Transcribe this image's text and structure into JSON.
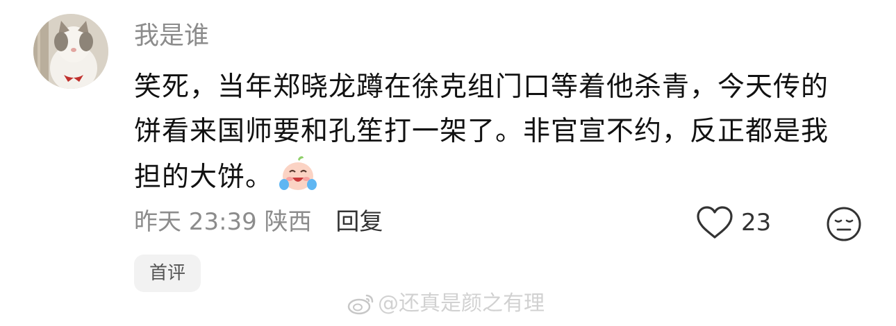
{
  "comment": {
    "username": "我是谁",
    "content_lines": [
      "笑死，当年郑晓龙蹲在徐克组门口等着他杀青，今天传的",
      "饼看来国师要和孔笙打一架了。非官宣不约，反正都是我",
      "担的大饼。"
    ],
    "time": "昨天 23:39",
    "location": "陕西",
    "reply_label": "回复",
    "like_count": "23",
    "badge": "首评"
  },
  "watermark": {
    "text": "@还真是颜之有理"
  },
  "icons": {
    "like": "heart-outline-icon",
    "dislike": "meh-face-icon",
    "emoji": "laughing-crying-emoji",
    "watermark_logo": "weibo-logo"
  },
  "colors": {
    "text_primary": "#111111",
    "text_secondary": "#8c8c8c",
    "badge_bg": "#f2f2f2"
  }
}
